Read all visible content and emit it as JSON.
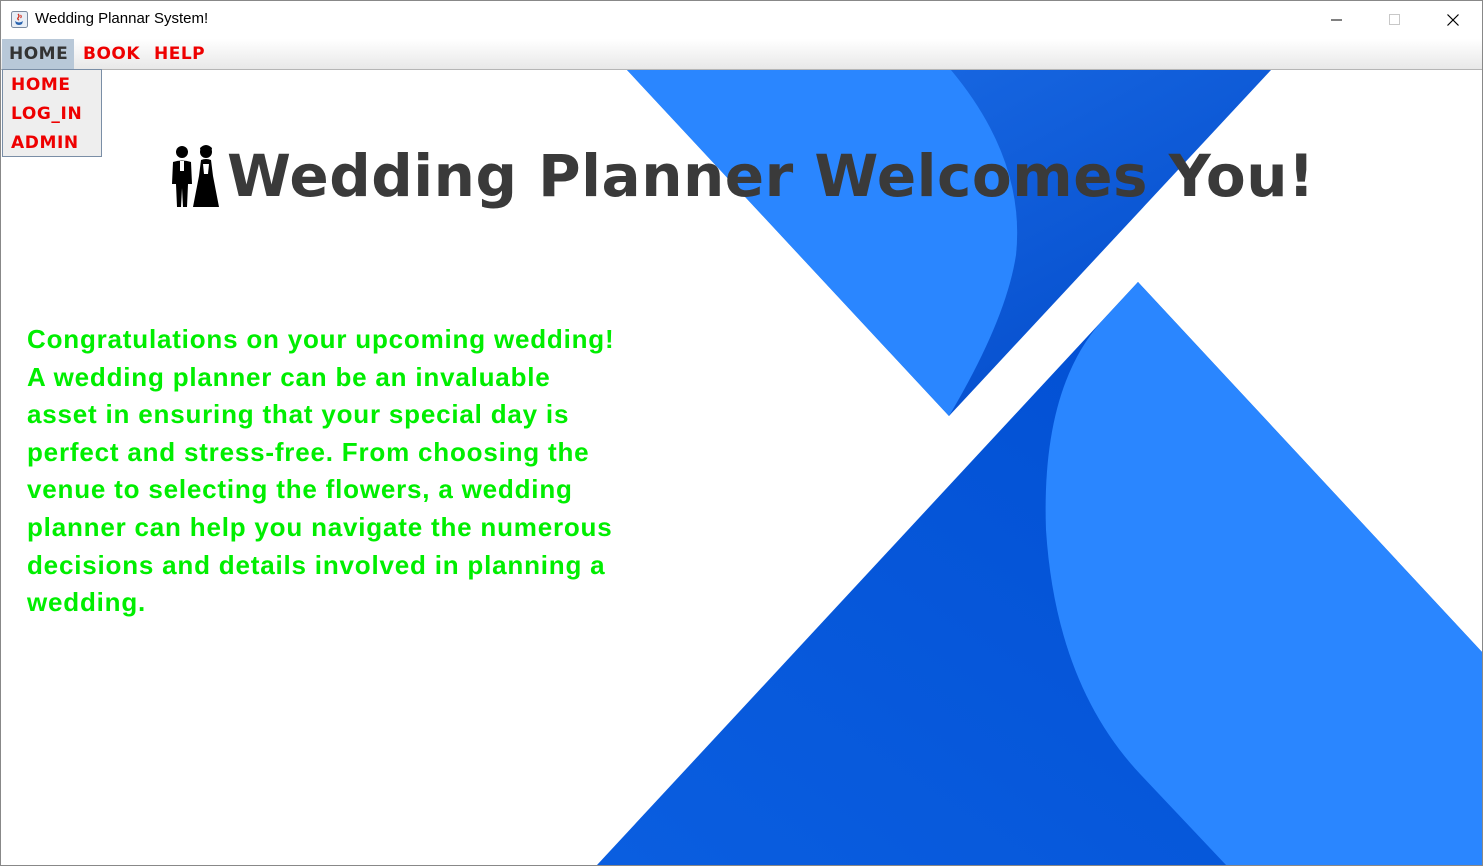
{
  "window": {
    "title": "Wedding Plannar System!",
    "controls": [
      "minimize",
      "maximize",
      "close"
    ]
  },
  "menubar": {
    "items": [
      {
        "label": "HOME",
        "active": true
      },
      {
        "label": "BOOK",
        "active": false
      },
      {
        "label": "HELP",
        "active": false
      }
    ]
  },
  "dropdown": {
    "items": [
      {
        "label": "HOME"
      },
      {
        "label": "LOG_IN"
      },
      {
        "label": "ADMIN"
      }
    ]
  },
  "main": {
    "heading": "Wedding Planner Welcomes You!",
    "heading_icon": "bride-groom-icon",
    "intro_lines": [
      "Congratulations on your upcoming wedding!",
      "A wedding planner can be an invaluable",
      "asset in ensuring that your special day is",
      "perfect and stress-free. From choosing the",
      "venue to selecting the flowers, a wedding",
      "planner can help you navigate the numerous",
      "decisions and details involved in planning a",
      "wedding."
    ]
  },
  "colors": {
    "menu_text": "#ee0000",
    "menu_active_bg": "#b8c8d8",
    "heading": "#3a3a3a",
    "intro_text": "#00ee00",
    "shape_light": "#2a86ff",
    "shape_dark": "#0050d0"
  }
}
